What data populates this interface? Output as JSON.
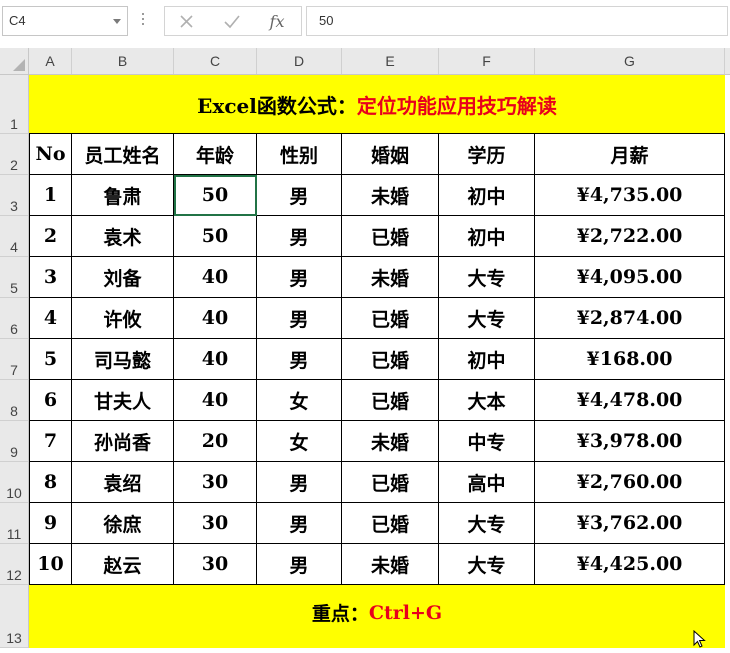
{
  "formula_bar": {
    "name_box": "C4",
    "cancel_icon": "close-icon",
    "enter_icon": "check-icon",
    "fx_label": "fx",
    "formula_value": "50"
  },
  "columns": [
    "A",
    "B",
    "C",
    "D",
    "E",
    "F",
    "G"
  ],
  "rows": [
    "1",
    "2",
    "3",
    "4",
    "5",
    "6",
    "7",
    "8",
    "9",
    "10",
    "11",
    "12",
    "13"
  ],
  "sheet": {
    "title_prefix": "Excel函数公式：",
    "title_suffix": "定位功能应用技巧解读",
    "header": [
      "No",
      "员工姓名",
      "年龄",
      "性别",
      "婚姻",
      "学历",
      "月薪"
    ],
    "data": [
      [
        "1",
        "鲁肃",
        "50",
        "男",
        "未婚",
        "初中",
        "¥4,735.00"
      ],
      [
        "2",
        "袁术",
        "50",
        "男",
        "已婚",
        "初中",
        "¥2,722.00"
      ],
      [
        "3",
        "刘备",
        "40",
        "男",
        "未婚",
        "大专",
        "¥4,095.00"
      ],
      [
        "4",
        "许攸",
        "40",
        "男",
        "已婚",
        "大专",
        "¥2,874.00"
      ],
      [
        "5",
        "司马懿",
        "40",
        "男",
        "已婚",
        "初中",
        "¥168.00"
      ],
      [
        "6",
        "甘夫人",
        "40",
        "女",
        "已婚",
        "大本",
        "¥4,478.00"
      ],
      [
        "7",
        "孙尚香",
        "20",
        "女",
        "未婚",
        "中专",
        "¥3,978.00"
      ],
      [
        "8",
        "袁绍",
        "30",
        "男",
        "已婚",
        "高中",
        "¥2,760.00"
      ],
      [
        "9",
        "徐庶",
        "30",
        "男",
        "已婚",
        "大专",
        "¥3,762.00"
      ],
      [
        "10",
        "赵云",
        "30",
        "男",
        "未婚",
        "大专",
        "¥4,425.00"
      ]
    ],
    "note_prefix": "重点：",
    "note_suffix": "Ctrl+G"
  },
  "colors": {
    "highlight": "#ffff00",
    "accent_red": "#e8001c",
    "selection": "#217346"
  }
}
